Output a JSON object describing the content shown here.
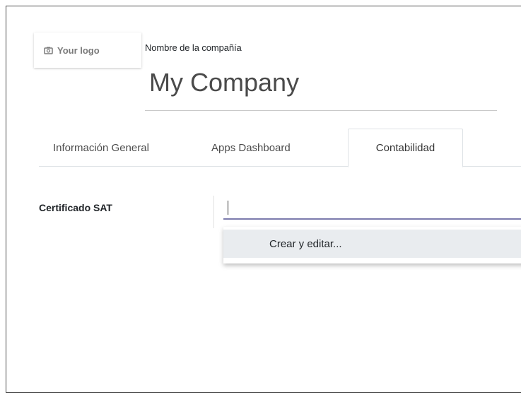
{
  "logo": {
    "label": "Your logo",
    "icon": "camera-icon"
  },
  "company": {
    "field_label": "Nombre de la compañía",
    "name": "My Company"
  },
  "tabs": [
    {
      "label": "Información General",
      "active": false
    },
    {
      "label": "Apps Dashboard",
      "active": false
    },
    {
      "label": "Contabilidad",
      "active": true
    }
  ],
  "sat_field": {
    "label": "Certificado SAT",
    "value": ""
  },
  "dropdown": {
    "items": [
      {
        "label": "Crear y editar..."
      }
    ]
  },
  "colors": {
    "input_underline": "#7c7bad",
    "dropdown_highlight": "#e9ecef",
    "tab_border": "#dee2e6"
  }
}
